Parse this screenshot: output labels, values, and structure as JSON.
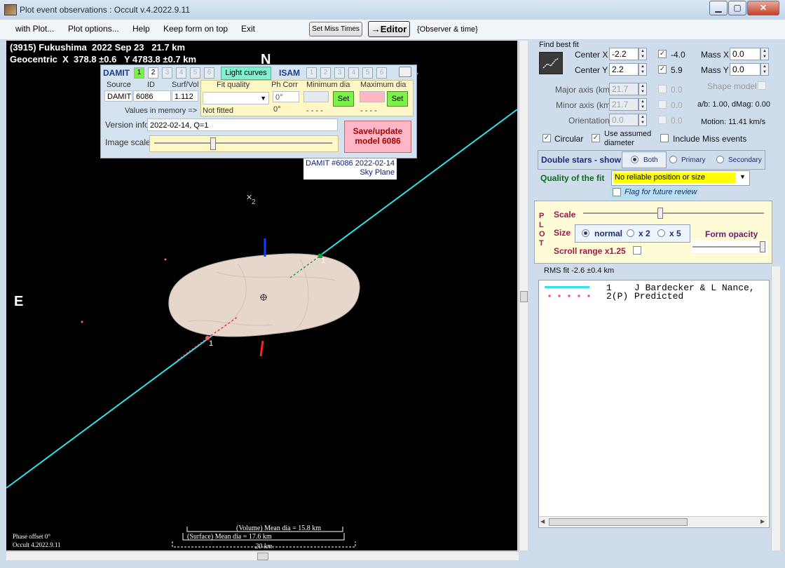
{
  "window": {
    "title": "Plot event observations : Occult v.4.2022.9.11"
  },
  "menu": {
    "items": [
      "with Plot...",
      "Plot options...",
      "Help",
      "Keep form on top",
      "Exit"
    ],
    "set_miss_times": "Set Miss Times",
    "editor": "→Editor",
    "observer_time": "{Observer & time}"
  },
  "plot": {
    "header_line1": "(3915) Fukushima  2022 Sep 23   21.7 km",
    "header_line2": "Geocentric  X  378.8 ±0.6   Y 4783.8 ±0.7 km",
    "north": "N",
    "east": "E",
    "damit_caption": "DAMIT #6086 2022-02-14",
    "sky_plane": "Sky Plane",
    "chord1_label_a": "1",
    "chord1_label_b": "1",
    "star_label": "2",
    "phase_offset": "Phase offset 0°",
    "version": "Occult 4.2022.9.11",
    "volume_dia": "(Volume) Mean dia = 15.8 km",
    "surface_dia": "(Surface) Mean dia = 17.6 km",
    "scale_bar": "20 km",
    "colors": {
      "chord": "#33e0e8",
      "shape": "#e6d6cc",
      "predicted": "#ff4d6d"
    }
  },
  "damit_panel": {
    "damit_label": "DAMIT",
    "damit_tabs": [
      "1",
      "2",
      "3",
      "4",
      "5",
      "6"
    ],
    "light_curves": "Light curves",
    "isam_label": "ISAM",
    "isam_tabs": [
      "1",
      "2",
      "3",
      "4",
      "5",
      "6"
    ],
    "headers": {
      "source": "Source",
      "id": "ID",
      "surf_vol": "Surf/Vol",
      "fit_quality": "Fit quality",
      "ph_corr": "Ph Corr",
      "min_dia": "Minimum dia",
      "max_dia": "Maximum dia"
    },
    "source_value": "DAMIT",
    "id_value": "6086",
    "surf_vol_value": "1.112",
    "ph_corr_value": "0°",
    "set1": "Set",
    "set2": "Set",
    "values_in_memory": "Values in memory =>",
    "not_fitted": "Not fitted",
    "mem_ph_corr": "0°",
    "mem_min": "- - - -",
    "mem_max": "- - - -",
    "version_info_label": "Version info",
    "version_info_value": "2022-02-14, Q=1",
    "image_scale_label": "Image scale",
    "save_update": "Save/update",
    "model": "model 6086"
  },
  "fit": {
    "find_best_fit": "Find best fit",
    "center_x_label": "Center X",
    "center_x": "-2.2",
    "center_y_label": "Center Y",
    "center_y": "2.2",
    "center_x_fit": "-4.0",
    "center_y_fit": "5.9",
    "mass_x_label": "Mass X",
    "mass_x": "0.0",
    "mass_y_label": "Mass Y",
    "mass_y": "0.0",
    "major_label": "Major axis (km)",
    "major": "21.7",
    "major_fit": "0.0",
    "minor_label": "Minor axis (km)",
    "minor": "21.7",
    "minor_fit": "0.0",
    "orient_label": "Orientation",
    "orient": "0.0",
    "orient_fit": "0.0",
    "shape_model": "Shape model",
    "ab_dmag": "a/b: 1.00, dMag: 0.00",
    "motion": "Motion: 11.41 km/s",
    "circular": "Circular",
    "use_assumed_1": "Use assumed",
    "use_assumed_2": "diameter",
    "include_miss": "Include Miss events",
    "double_stars": "Double stars - show",
    "both": "Both",
    "primary": "Primary",
    "secondary": "Secondary",
    "quality_label": "Quality of the fit",
    "quality_value": "No reliable position or size",
    "flag_review": "Flag for future review"
  },
  "plot_panel": {
    "letters": [
      "P",
      "L",
      "O",
      "T"
    ],
    "scale": "Scale",
    "size": "Size",
    "normal": "normal",
    "x2": "x 2",
    "x5": "x 5",
    "form_opacity": "Form opacity",
    "scroll_range": "Scroll range x1.25"
  },
  "rms_fit": "RMS fit -2.6 ±0.4 km",
  "legend": {
    "rows": [
      {
        "num": "1",
        "name": "J Bardecker & L Nance,"
      },
      {
        "num": "2(P)",
        "name": "Predicted"
      }
    ]
  }
}
